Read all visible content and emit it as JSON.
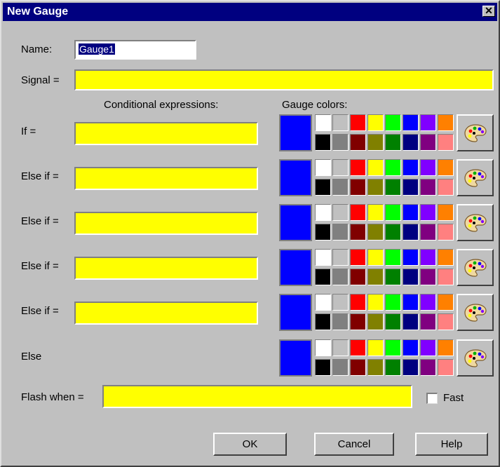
{
  "window": {
    "title": "New Gauge"
  },
  "name": {
    "label": "Name:",
    "value": "Gauge1"
  },
  "signal": {
    "label": "Signal =",
    "value": ""
  },
  "headers": {
    "conditional": "Conditional expressions:",
    "gauge_colors": "Gauge colors:"
  },
  "conditions": [
    {
      "label": "If =",
      "has_field": true,
      "value": "",
      "selected_color": "#0000ff"
    },
    {
      "label": "Else if =",
      "has_field": true,
      "value": "",
      "selected_color": "#0000ff"
    },
    {
      "label": "Else if =",
      "has_field": true,
      "value": "",
      "selected_color": "#0000ff"
    },
    {
      "label": "Else if =",
      "has_field": true,
      "value": "",
      "selected_color": "#0000ff"
    },
    {
      "label": "Else if =",
      "has_field": true,
      "value": "",
      "selected_color": "#0000ff"
    },
    {
      "label": "Else",
      "has_field": false,
      "value": "",
      "selected_color": "#0000ff"
    }
  ],
  "palette": {
    "top": [
      "#ffffff",
      "#c0c0c0",
      "#ff0000",
      "#ffff00",
      "#00ff00",
      "#0000ff",
      "#8000ff",
      "#ff8000"
    ],
    "bottom": [
      "#000000",
      "#808080",
      "#800000",
      "#808000",
      "#008000",
      "#000080",
      "#800080",
      "#ff8080"
    ]
  },
  "flash": {
    "label": "Flash when =",
    "value": ""
  },
  "fast": {
    "label": "Fast",
    "checked": false
  },
  "buttons": {
    "ok": "OK",
    "cancel": "Cancel",
    "help": "Help"
  },
  "colors": {
    "field": "#ffff00",
    "titlebar": "#000080",
    "face": "#c0c0c0"
  }
}
